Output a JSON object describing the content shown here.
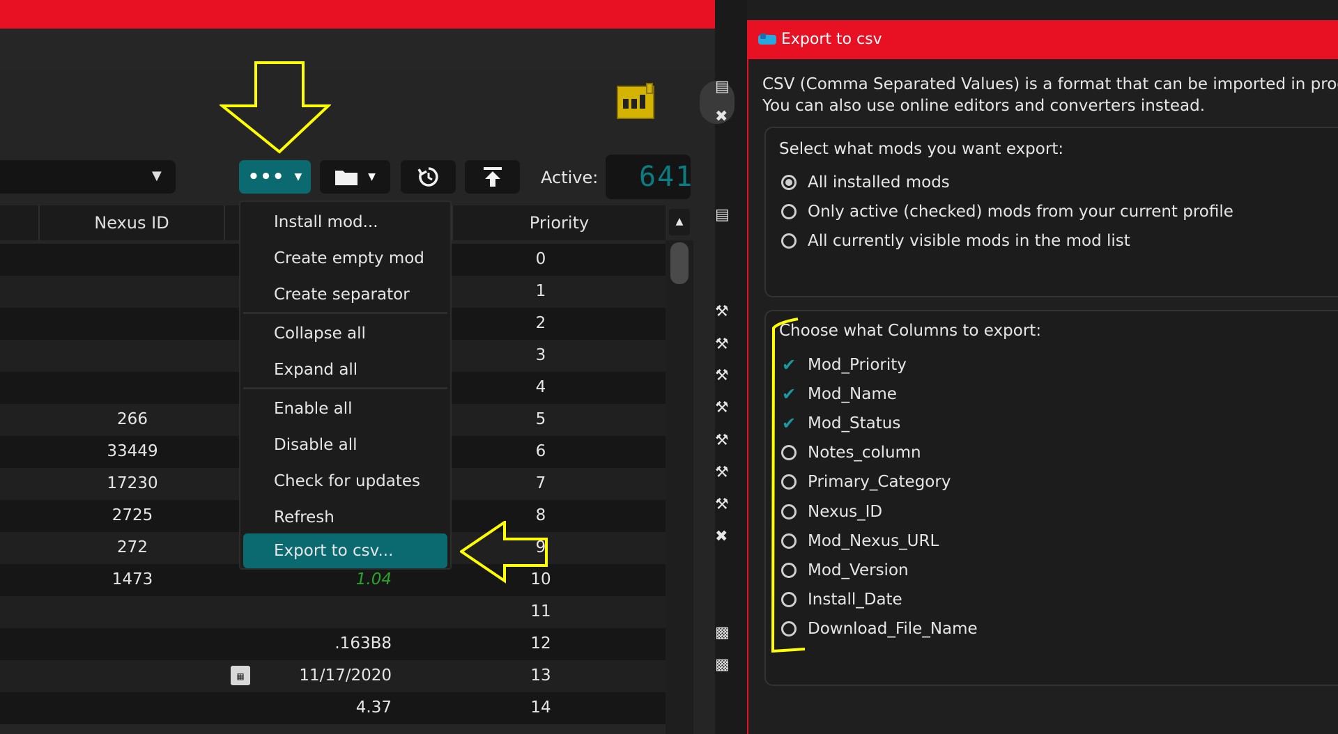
{
  "colors": {
    "titlebar_red": "#e81123",
    "accent_teal": "#0b6a6f",
    "annotation_yellow": "#ffff00",
    "row_dark": "#161616",
    "row_light": "#202020"
  },
  "toolbar": {
    "menu_icon": "more-dots-icon",
    "folder_icon": "folder-icon",
    "restore_icon": "restore-icon",
    "upload_icon": "upload-icon",
    "active_label": "Active:",
    "active_count": "641"
  },
  "table": {
    "columns": {
      "nexus_id": "Nexus ID",
      "priority": "Priority"
    },
    "rows": [
      {
        "nexus": "",
        "version": "",
        "priority": "0"
      },
      {
        "nexus": "",
        "version": "",
        "priority": "1"
      },
      {
        "nexus": "",
        "version": "",
        "priority": "2"
      },
      {
        "nexus": "",
        "version": "",
        "priority": "3"
      },
      {
        "nexus": "",
        "version": "",
        "priority": "4"
      },
      {
        "nexus": "266",
        "version": "",
        "priority": "5"
      },
      {
        "nexus": "33449",
        "version": "",
        "priority": "6"
      },
      {
        "nexus": "17230",
        "version": "",
        "priority": "7"
      },
      {
        "nexus": "2725",
        "version": "",
        "priority": "8"
      },
      {
        "nexus": "272",
        "version": "",
        "priority": "9"
      },
      {
        "nexus": "1473",
        "version": "1.04",
        "priority": "10"
      },
      {
        "nexus": "",
        "version": "",
        "priority": "11"
      },
      {
        "nexus": "",
        "version": ".163B8",
        "priority": "12"
      },
      {
        "nexus": "",
        "version": "11/17/2020",
        "priority": "13"
      },
      {
        "nexus": "",
        "version": "4.37",
        "priority": "14"
      }
    ]
  },
  "menu": {
    "install_mod": "Install mod...",
    "create_empty_mod": "Create empty mod",
    "create_separator": "Create separator",
    "collapse_all": "Collapse all",
    "expand_all": "Expand all",
    "enable_all": "Enable all",
    "disable_all": "Disable all",
    "check_for_updates": "Check for updates",
    "refresh": "Refresh",
    "export_to_csv": "Export to csv..."
  },
  "dialog": {
    "title": "Export to csv",
    "intro_line1": "CSV (Comma Separated Values) is a format that can be imported in progra",
    "intro_line2": "You can also use online editors and converters instead.",
    "mods_group_label": "Select what mods you want export:",
    "mods_options": [
      {
        "label": "All installed mods",
        "selected": true
      },
      {
        "label": "Only active (checked) mods from your current profile",
        "selected": false
      },
      {
        "label": "All currently visible mods in the mod list",
        "selected": false
      }
    ],
    "columns_group_label": "Choose what Columns to export:",
    "column_options": [
      {
        "label": "Mod_Priority",
        "checked": true
      },
      {
        "label": "Mod_Name",
        "checked": true
      },
      {
        "label": "Mod_Status",
        "checked": true
      },
      {
        "label": "Notes_column",
        "checked": false
      },
      {
        "label": "Primary_Category",
        "checked": false
      },
      {
        "label": "Nexus_ID",
        "checked": false
      },
      {
        "label": "Mod_Nexus_URL",
        "checked": false
      },
      {
        "label": "Mod_Version",
        "checked": false
      },
      {
        "label": "Install_Date",
        "checked": false
      },
      {
        "label": "Download_File_Name",
        "checked": false
      }
    ]
  }
}
